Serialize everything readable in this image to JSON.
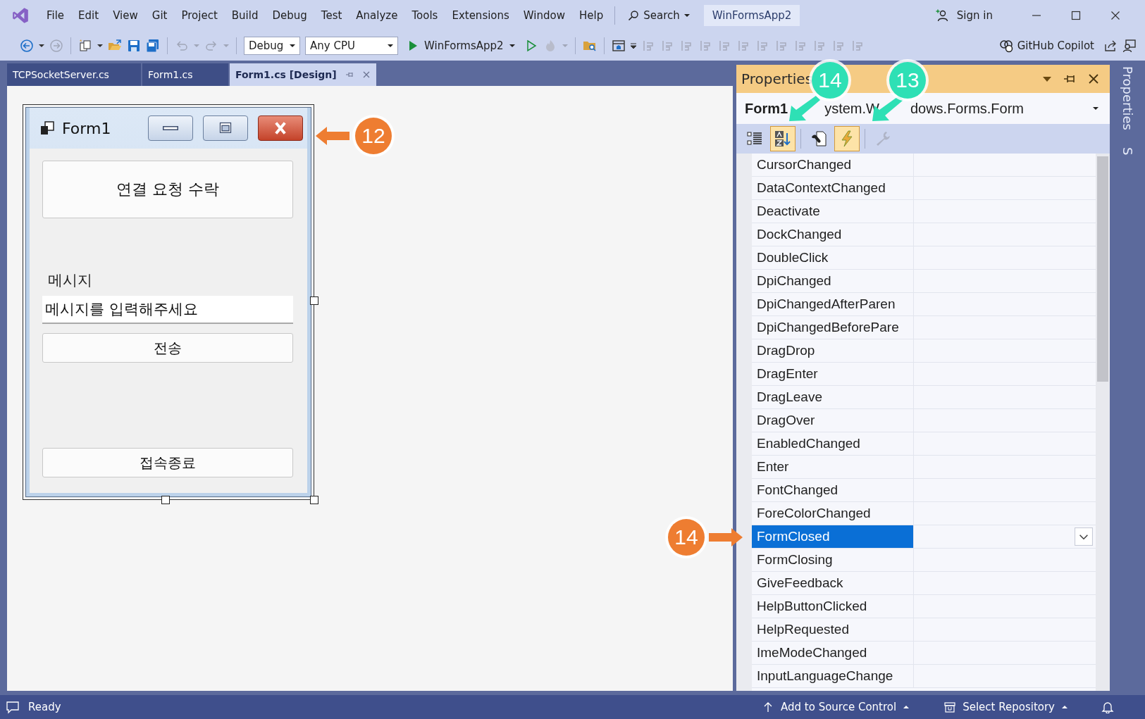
{
  "menu": [
    "File",
    "Edit",
    "View",
    "Git",
    "Project",
    "Build",
    "Debug",
    "Test",
    "Analyze",
    "Tools",
    "Extensions",
    "Window",
    "Help"
  ],
  "search": "Search",
  "solution_title": "WinFormsApp2",
  "sign_in": "Sign in",
  "toolbar": {
    "configuration": "Debug",
    "platform": "Any CPU",
    "startup_project": "WinFormsApp2",
    "copilot": "GitHub Copilot"
  },
  "doc_tabs": [
    {
      "label": "TCPSocketServer.cs",
      "selected": false
    },
    {
      "label": "Form1.cs",
      "selected": false
    },
    {
      "label": "Form1.cs [Design]",
      "selected": true
    }
  ],
  "form_preview": {
    "title": "Form1",
    "accept_button": "연결 요청 수락",
    "message_label": "메시지",
    "message_value": "메시지를 입력해주세요",
    "send_button": "전송",
    "disconnect_button": "접속종료"
  },
  "properties": {
    "title": "Properties",
    "object_name": "Form1",
    "object_type_parts": [
      "ystem.W",
      "dows.Forms.Form"
    ],
    "view_buttons": [
      {
        "kind": "categorized",
        "selected": false,
        "disabled": false
      },
      {
        "kind": "alphabetical",
        "selected": true,
        "disabled": false
      },
      {
        "kind": "properties",
        "selected": false,
        "disabled": false
      },
      {
        "kind": "events",
        "selected": true,
        "disabled": false
      },
      {
        "kind": "property-pages",
        "selected": false,
        "disabled": true
      }
    ],
    "events": [
      {
        "name": "CursorChanged",
        "selected": false
      },
      {
        "name": "DataContextChanged",
        "selected": false
      },
      {
        "name": "Deactivate",
        "selected": false
      },
      {
        "name": "DockChanged",
        "selected": false
      },
      {
        "name": "DoubleClick",
        "selected": false
      },
      {
        "name": "DpiChanged",
        "selected": false
      },
      {
        "name": "DpiChangedAfterParen",
        "selected": false
      },
      {
        "name": "DpiChangedBeforePare",
        "selected": false
      },
      {
        "name": "DragDrop",
        "selected": false
      },
      {
        "name": "DragEnter",
        "selected": false
      },
      {
        "name": "DragLeave",
        "selected": false
      },
      {
        "name": "DragOver",
        "selected": false
      },
      {
        "name": "EnabledChanged",
        "selected": false
      },
      {
        "name": "Enter",
        "selected": false
      },
      {
        "name": "FontChanged",
        "selected": false
      },
      {
        "name": "ForeColorChanged",
        "selected": false
      },
      {
        "name": "FormClosed",
        "selected": true
      },
      {
        "name": "FormClosing",
        "selected": false
      },
      {
        "name": "GiveFeedback",
        "selected": false
      },
      {
        "name": "HelpButtonClicked",
        "selected": false
      },
      {
        "name": "HelpRequested",
        "selected": false
      },
      {
        "name": "ImeModeChanged",
        "selected": false
      },
      {
        "name": "InputLanguageChange",
        "selected": false
      }
    ]
  },
  "side_tabs": [
    "Properties",
    "S"
  ],
  "annotations": [
    {
      "number": "12",
      "color": "#ee7d31"
    },
    {
      "number": "14",
      "color": "#ee7d31"
    },
    {
      "number": "14",
      "color": "#2ee0b5"
    },
    {
      "number": "13",
      "color": "#2ee0b5"
    }
  ],
  "status_bar": {
    "text": "Ready",
    "source_control": "Add to Source Control",
    "repository": "Select Repository"
  }
}
